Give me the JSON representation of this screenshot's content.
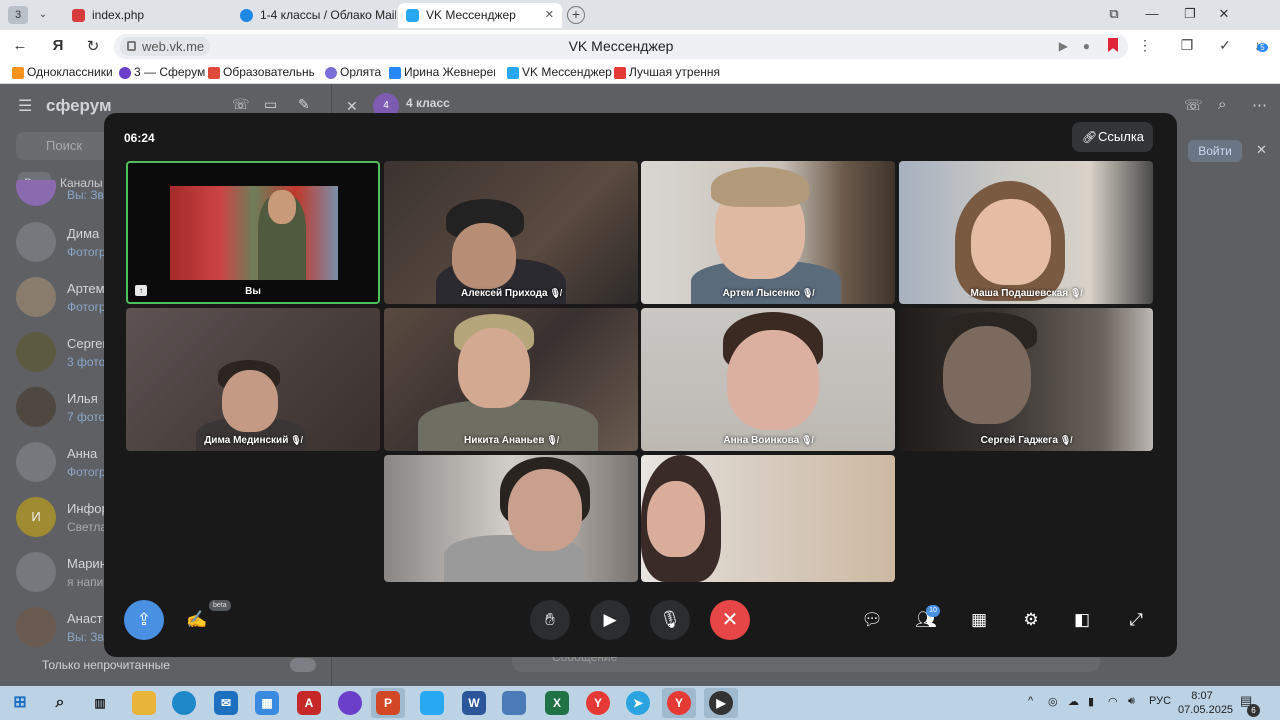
{
  "browser": {
    "tab_count": "3",
    "tabs": [
      {
        "label": "index.php",
        "favicon_color": "#d83b3b"
      },
      {
        "label": "1-4 классы / Облако Mail",
        "favicon_color": "#1e88e5"
      },
      {
        "label": "VK Мессенджер",
        "favicon_color": "#27a8f0",
        "active": true
      }
    ],
    "new_tab": "+",
    "window_controls": [
      "⧉",
      "—",
      "❐",
      "✕"
    ],
    "address": {
      "domain": "web.vk.me",
      "page_title": "VK Мессенджер"
    },
    "bookmarks": [
      {
        "label": "Одноклассники",
        "color": "#f7931e"
      },
      {
        "label": "3 — Сферум",
        "color": "#6b3fc9"
      },
      {
        "label": "Образовательны",
        "color": "#e04a3a"
      },
      {
        "label": "Орлята",
        "color": "#7a6fd8"
      },
      {
        "label": "Ирина Жевнерев",
        "color": "#2787f5"
      },
      {
        "label": "VK Мессенджер",
        "color": "#27a8f0"
      },
      {
        "label": "Лучшая утренняя",
        "color": "#e53935"
      }
    ],
    "download_badge": "5"
  },
  "background_app": {
    "logo": "сферум",
    "search_placeholder": "Поиск",
    "filters": [
      "Все",
      "Каналы"
    ],
    "chats": [
      {
        "name": "",
        "message": "Вы: Зво"
      },
      {
        "name": "Дима",
        "message": "Фотогр"
      },
      {
        "name": "Артем",
        "message": "Фотогр"
      },
      {
        "name": "Сергей",
        "message": "3 фото"
      },
      {
        "name": "Илья",
        "message": "7 фото"
      },
      {
        "name": "Анна",
        "message": "Фотогр"
      },
      {
        "name": "Инфор",
        "message": "Светла",
        "avatar_letter": "И"
      },
      {
        "name": "Марин",
        "message": "я напи"
      },
      {
        "name": "Анаст",
        "message": "Вы: Зво"
      }
    ],
    "unread_only": "Только непрочитанные",
    "chat_title": "4 класс",
    "chat_avatar": "4",
    "join_button": "Войти",
    "composer_placeholder": "Сообщение"
  },
  "call": {
    "timer": "06:24",
    "link_button": "Ссылка",
    "participants": [
      {
        "name": "Вы",
        "muted": false,
        "self": true
      },
      {
        "name": "Алексей Приходa",
        "muted": true
      },
      {
        "name": "Артем Лысенко",
        "muted": true
      },
      {
        "name": "Маша Подашевская",
        "muted": true
      },
      {
        "name": "Дима Мединский",
        "muted": true
      },
      {
        "name": "Никита Ананьев",
        "muted": true
      },
      {
        "name": "Анна Воинкова",
        "muted": true
      },
      {
        "name": "Сергей Гаджега",
        "muted": true
      },
      {
        "name": "",
        "muted": false
      },
      {
        "name": "",
        "muted": false
      }
    ],
    "controls": {
      "beta_label": "beta",
      "participants_count": "10"
    }
  },
  "taskbar": {
    "language": "РУС",
    "time": "8:07",
    "date": "07.05.2025",
    "notification_count": "6"
  }
}
